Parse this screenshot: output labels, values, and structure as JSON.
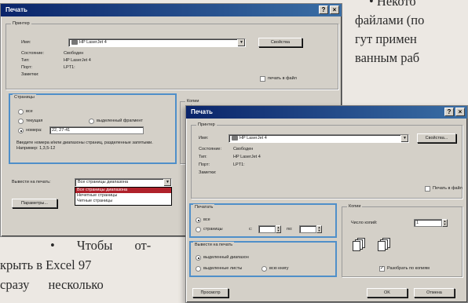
{
  "article": {
    "top_lines": [
      "• Некото",
      "файлами (по",
      "гут примен",
      "ванным раб"
    ],
    "bottom_lines": [
      "• Чтобы от-",
      "крыть в Excel 97",
      "сразу несколько"
    ]
  },
  "back_dialog": {
    "title": "Печать",
    "title_buttons": [
      "?",
      "×"
    ],
    "printer_group": "Принтер",
    "name_label": "Имя:",
    "name_value": "HP LaserJet 4",
    "properties_button": "Свойства",
    "status_label": "Состояние:",
    "status_value": "Свободен",
    "type_label": "Тип:",
    "type_value": "HP LaserJet 4",
    "port_label": "Порт:",
    "port_value": "LPT1:",
    "comment_label": "Заметки:",
    "print_to_file": "печать в файл",
    "pages_group": "Страницы",
    "opt_all": "все",
    "opt_current": "текущая",
    "opt_selection": "выделенный фрагмент",
    "opt_numbers": "номера:",
    "numbers_value": "22, 27-41",
    "hint": "Введите номера и/или диапазоны страниц, разделенные запятыми. Например: 1,3,5-12",
    "copies_group": "Копии",
    "print_what_label": "Вывести на печать:",
    "print_what_value": "Все страницы диапазона",
    "print_what_options": [
      "Все страницы диапазона",
      "Нечетные страницы",
      "Четные страницы"
    ],
    "options_button": "Параметры..."
  },
  "front_dialog": {
    "title": "Печать",
    "title_buttons": [
      "?",
      "×"
    ],
    "printer_group": "Принтер",
    "name_label": "Имя:",
    "name_value": "HP LaserJet 4",
    "properties_button": "Свойства...",
    "status_label": "Состояние:",
    "status_value": "Свободен",
    "type_label": "Тип:",
    "type_value": "HP LaserJet 4",
    "port_label": "Порт:",
    "port_value": "LPT1:",
    "comment_label": "Заметки:",
    "print_to_file": "Печать в файл",
    "range_group": "Печатать",
    "opt_all": "все",
    "opt_pages": "страницы",
    "from_label": "с:",
    "to_label": "по:",
    "output_group": "Вывести на печать",
    "opt_sel_range": "выделенный диапазон",
    "opt_sel_sheets": "выделенные листы",
    "opt_whole_book": "всю книгу",
    "copies_group": "Копии",
    "copies_label": "Число копий:",
    "copies_value": "1",
    "collate_label": "Разобрать по копиям",
    "preview_button": "Просмотр",
    "ok_button": "OK",
    "cancel_button": "Отмена"
  },
  "colors": {
    "title_gradient_start": "#0a246a",
    "title_gradient_end": "#3a6ea5",
    "highlight": "#4f8fc9",
    "selected_item": "#b0212b"
  }
}
